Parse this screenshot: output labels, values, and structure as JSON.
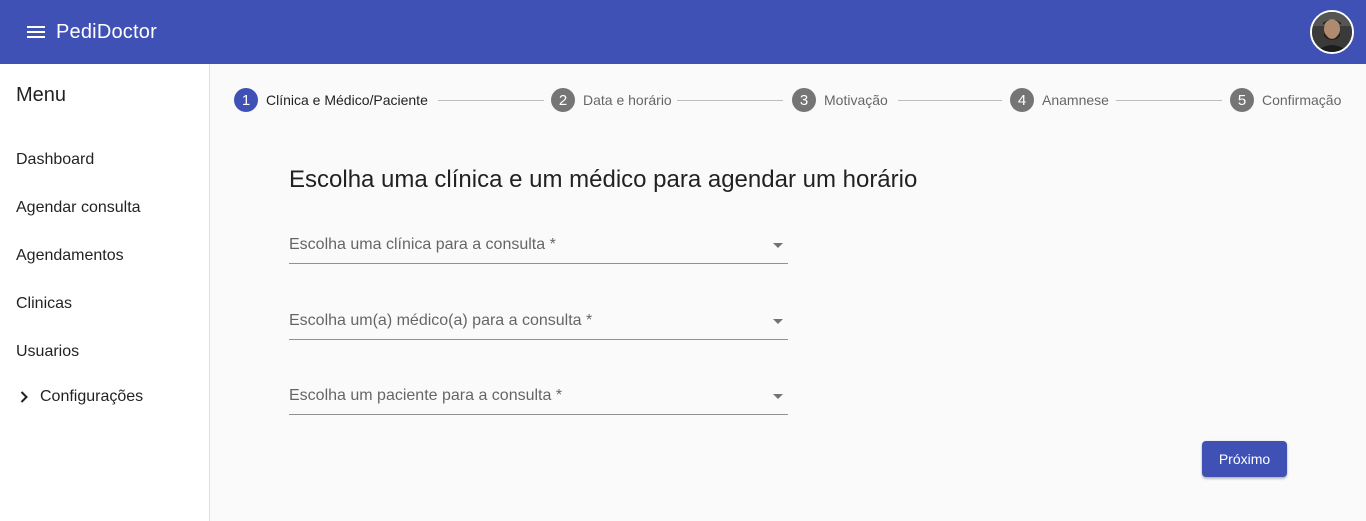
{
  "app": {
    "title": "PediDoctor"
  },
  "sidebar": {
    "title": "Menu",
    "items": [
      {
        "label": "Dashboard"
      },
      {
        "label": "Agendar consulta"
      },
      {
        "label": "Agendamentos"
      },
      {
        "label": "Clinicas"
      },
      {
        "label": "Usuarios"
      },
      {
        "label": "Configurações",
        "expandable": true
      }
    ]
  },
  "stepper": {
    "active_step": 1,
    "steps": [
      {
        "number": "1",
        "label": "Clínica e Médico/Paciente"
      },
      {
        "number": "2",
        "label": "Data e horário"
      },
      {
        "number": "3",
        "label": "Motivação"
      },
      {
        "number": "4",
        "label": "Anamnese"
      },
      {
        "number": "5",
        "label": "Confirmação"
      }
    ]
  },
  "form": {
    "title": "Escolha uma clínica e um médico para agendar um horário",
    "clinic_select": {
      "placeholder": "Escolha uma clínica para a consulta *"
    },
    "doctor_select": {
      "placeholder": "Escolha um(a) médico(a) para a consulta *"
    },
    "patient_select": {
      "placeholder": "Escolha um paciente para a consulta *"
    },
    "next_label": "Próximo"
  },
  "colors": {
    "primary": "#3f51b5",
    "step_inactive": "#757575"
  },
  "icons": {
    "menu": "menu-icon",
    "chevron": "chevron-right-icon",
    "dropdown": "dropdown-arrow-icon"
  }
}
